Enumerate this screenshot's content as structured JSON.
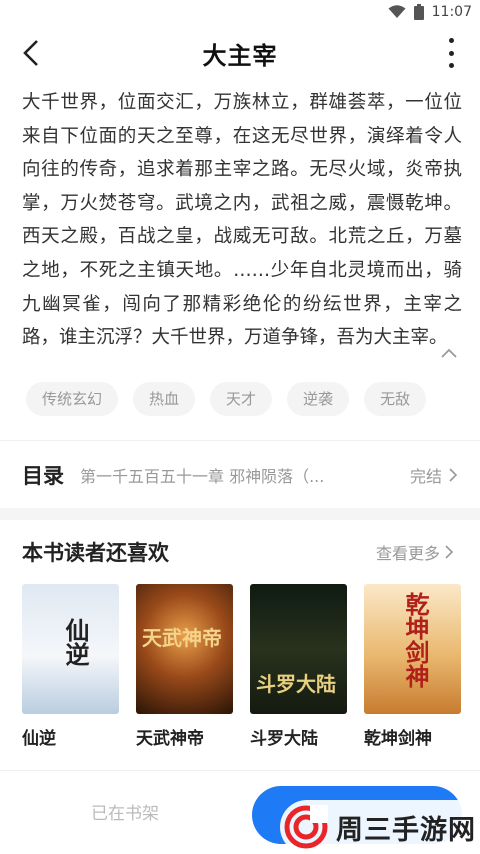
{
  "status_bar": {
    "time": "11:07"
  },
  "header": {
    "title": "大主宰"
  },
  "description": "大千世界，位面交汇，万族林立，群雄荟萃，一位位来自下位面的天之至尊，在这无尽世界，演绎着令人向往的传奇，追求着那主宰之路。无尽火域，炎帝执掌，万火焚苍穹。武境之内，武祖之威，震慑乾坤。西天之殿，百战之皇，战威无可敌。北荒之丘，万墓之地，不死之主镇天地。……少年自北灵境而出，骑九幽冥雀，闯向了那精彩绝伦的纷纭世界，主宰之路，谁主沉浮？大千世界，万道争锋，吾为大主宰。",
  "tags": [
    "传统玄幻",
    "热血",
    "天才",
    "逆袭",
    "无敌"
  ],
  "catalog": {
    "label": "目录",
    "chapter": "第一千五百五十一章 邪神陨落（...",
    "status": "完结"
  },
  "recommend": {
    "title": "本书读者还喜欢",
    "more_label": "查看更多",
    "books": [
      {
        "name": "仙逆",
        "cover_text": "仙逆"
      },
      {
        "name": "天武神帝",
        "cover_text": "天武神帝"
      },
      {
        "name": "斗罗大陆",
        "cover_text": "斗罗大陆"
      },
      {
        "name": "乾坤剑神",
        "cover_text": "乾坤剑神"
      }
    ]
  },
  "bottom": {
    "shelf_label": "已在书架"
  },
  "watermark": {
    "text": "周三手游网"
  },
  "colors": {
    "primary": "#1e7bf5",
    "muted": "#999999",
    "tag_bg": "#f4f4f4"
  }
}
